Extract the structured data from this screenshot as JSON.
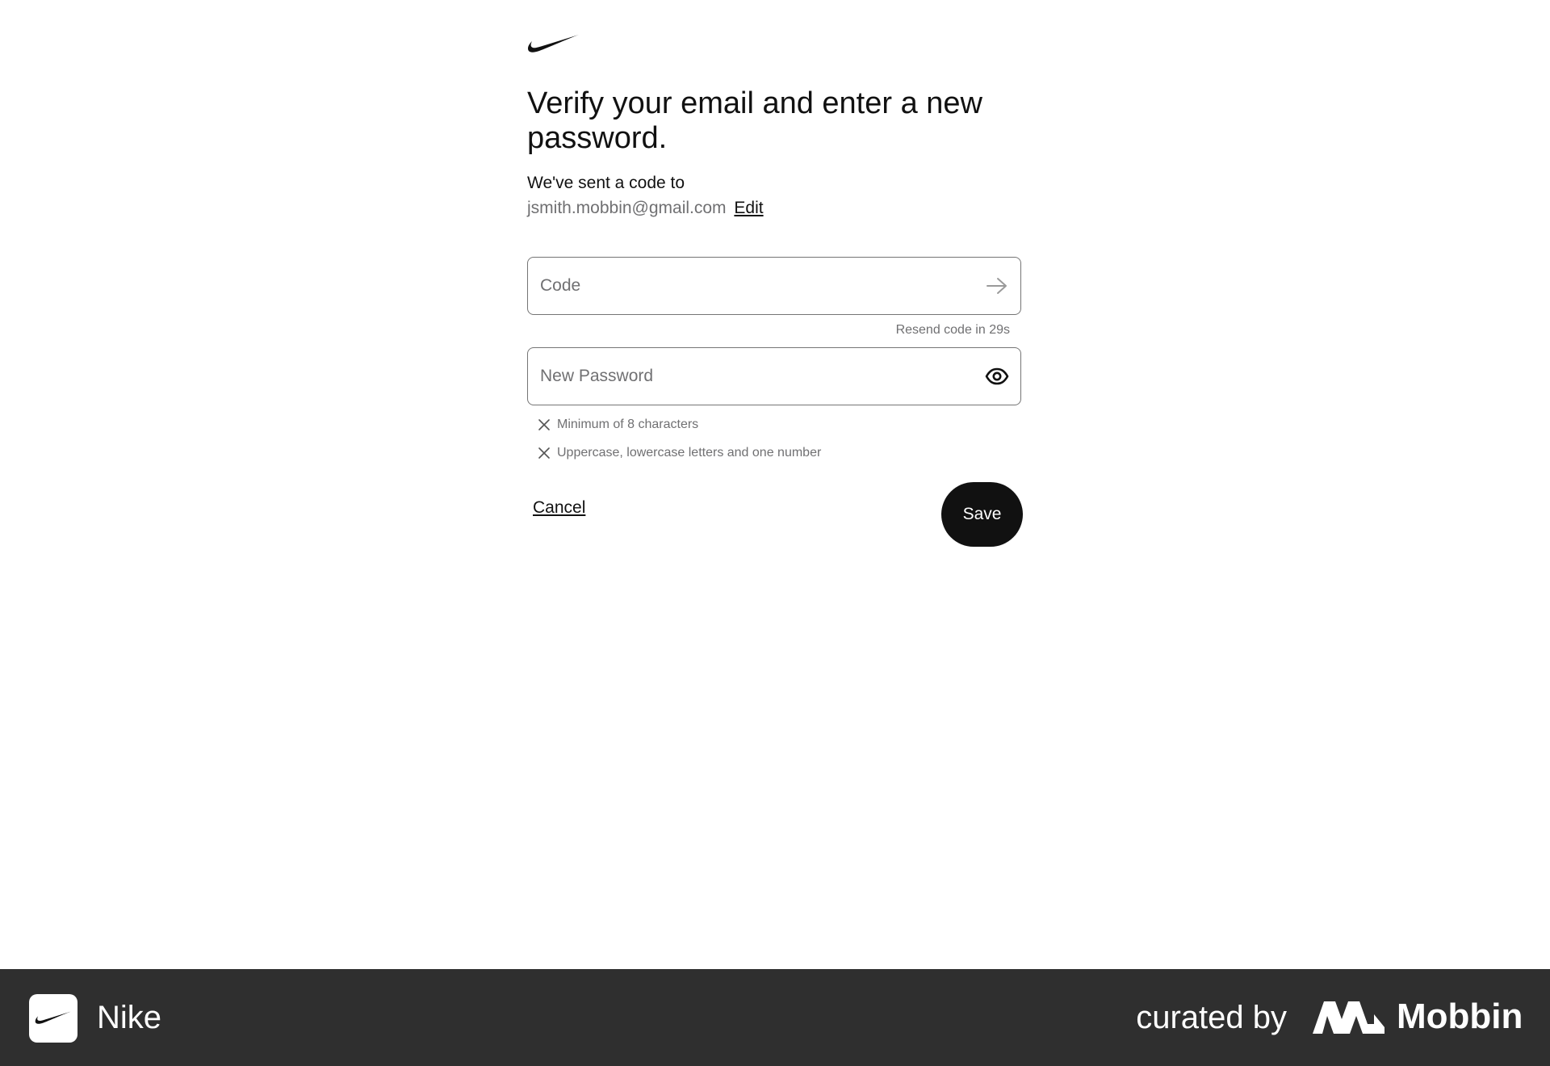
{
  "page": {
    "title": "Verify your email and enter a new password.",
    "subtitle": "We've sent a code to",
    "email": "jsmith.mobbin@gmail.com",
    "edit_label": "Edit"
  },
  "form": {
    "code_placeholder": "Code",
    "resend_text": "Resend code in 29s",
    "password_placeholder": "New Password",
    "requirements": [
      "Minimum of 8 characters",
      "Uppercase, lowercase letters and one number"
    ],
    "cancel_label": "Cancel",
    "save_label": "Save"
  },
  "icons": {
    "logo": "nike-swoosh-icon",
    "code_submit": "arrow-right-icon",
    "password_toggle": "eye-icon",
    "requirement_status": "close-x-icon"
  },
  "footer": {
    "app_name": "Nike",
    "curated_by": "curated by",
    "brand": "Mobbin"
  },
  "colors": {
    "primary_text": "#111111",
    "secondary_text": "#707072",
    "button_bg": "#111111",
    "footer_bg": "#2f2f2f"
  }
}
